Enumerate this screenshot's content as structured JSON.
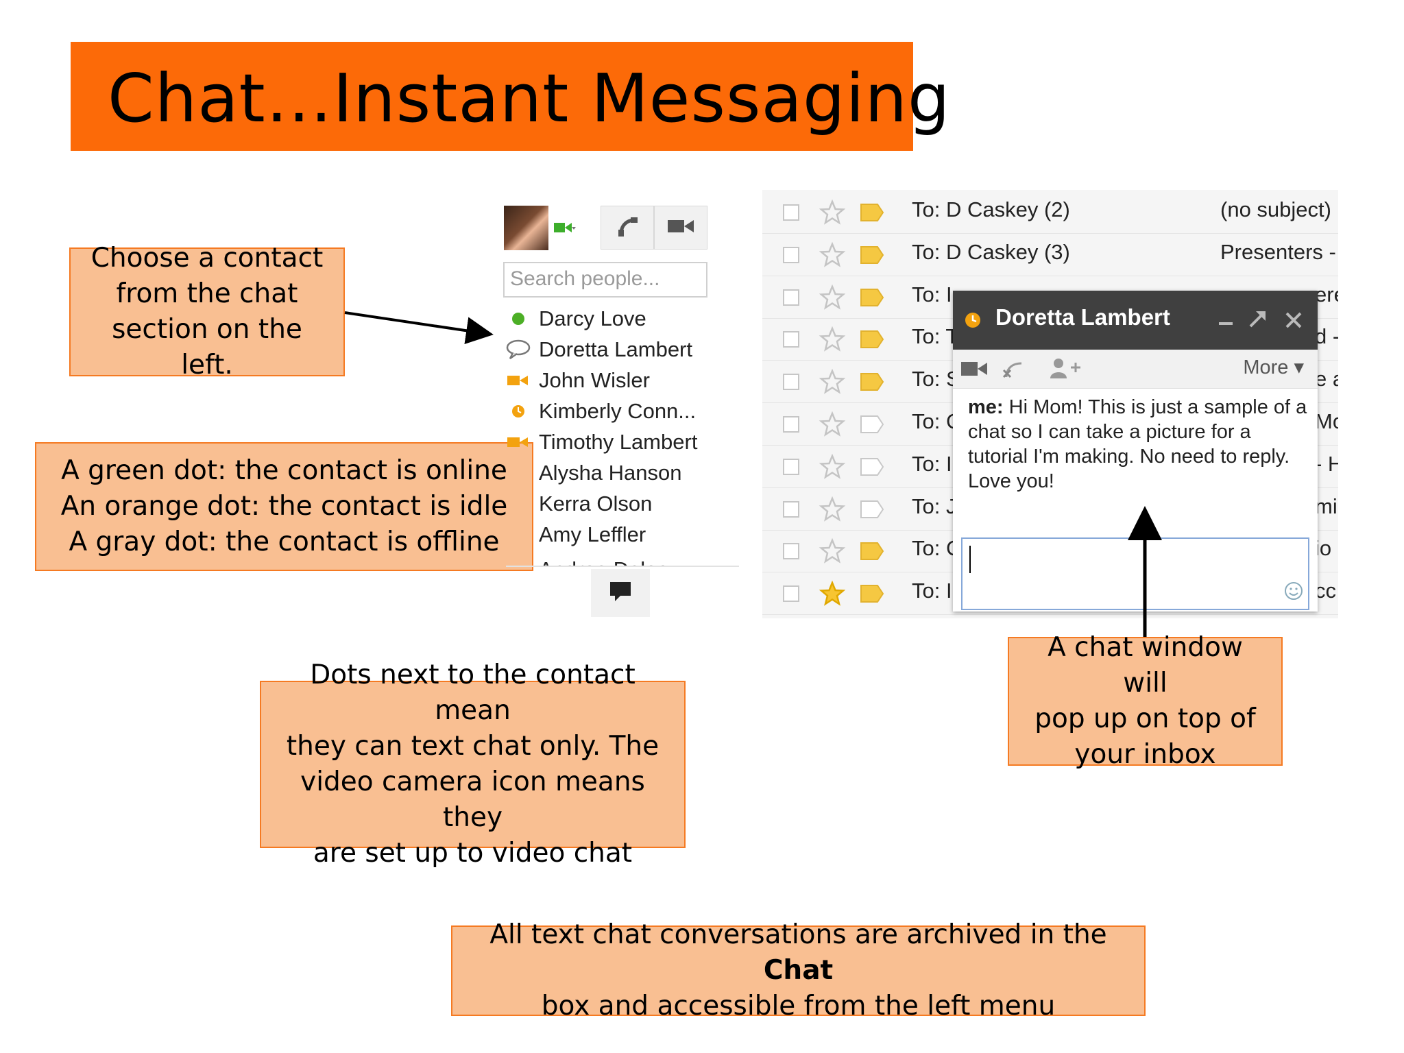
{
  "title": "Chat…Instant Messaging",
  "callouts": {
    "choose": "Choose a contact\nfrom the chat\nsection on the left.",
    "dots": "A green dot: the contact is online\nAn orange dot: the contact is idle\nA gray dot: the contact is offline",
    "text_only": "Dots next to the contact mean\nthey can text chat only.  The\nvideo camera icon means they\nare set up to video chat",
    "popup": "A chat window will\npop up on top of\nyour inbox",
    "archive_before": "All text chat conversations are archived in the ",
    "archive_bold": "Chat",
    "archive_after": "\nbox and accessible from the left menu"
  },
  "chat_panel": {
    "search_placeholder": "Search people...",
    "contacts": [
      {
        "name": "Darcy Love",
        "icon": "green-dot-icon"
      },
      {
        "name": "Doretta Lambert",
        "icon": "speech-bubble-icon"
      },
      {
        "name": "John Wisler",
        "icon": "video-camera-icon"
      },
      {
        "name": "Kimberly Conn...",
        "icon": "orange-idle-dot-icon"
      },
      {
        "name": "Timothy Lambert",
        "icon": "video-camera-icon"
      },
      {
        "name": "Alysha Hanson",
        "icon": ""
      },
      {
        "name": "Kerra Olson",
        "icon": ""
      },
      {
        "name": "Amy Leffler",
        "icon": ""
      },
      {
        "name": "Andrea Dalea",
        "icon": ""
      }
    ]
  },
  "inbox": {
    "rows": [
      {
        "to": "To: D Caskey (2)",
        "subject": "(no subject)",
        "edge": "",
        "starred": false,
        "tag": "yellow"
      },
      {
        "to": "To: D Caskey (3)",
        "subject": "Presenters -",
        "edge": "",
        "starred": false,
        "tag": "yellow"
      },
      {
        "to": "To: I",
        "subject": "",
        "edge": "ere",
        "starred": false,
        "tag": "yellow"
      },
      {
        "to": "To: T",
        "subject": "",
        "edge": "d -",
        "starred": false,
        "tag": "yellow"
      },
      {
        "to": "To: S",
        "subject": "",
        "edge": "e a",
        "starred": false,
        "tag": "yellow"
      },
      {
        "to": "To: C",
        "subject": "",
        "edge": "Mo",
        "starred": false,
        "tag": "white"
      },
      {
        "to": "To: I",
        "subject": "",
        "edge": "- H",
        "starred": false,
        "tag": "white"
      },
      {
        "to": "To: J",
        "subject": "",
        "edge": "mil",
        "starred": false,
        "tag": "white"
      },
      {
        "to": "To: C",
        "subject": "",
        "edge": "io",
        "starred": false,
        "tag": "yellow"
      },
      {
        "to": "To: I",
        "subject": "",
        "edge": "cc",
        "starred": true,
        "tag": "yellow"
      }
    ]
  },
  "chat_window": {
    "contact": "Doretta Lambert",
    "more_label": "More ▾",
    "sender": "me:",
    "message": "Hi Mom!  This is just a sample of a chat so I can take a picture for a tutorial I'm making.  No need to reply.  Love you!"
  },
  "colors": {
    "title_orange": "#fc6a08",
    "callout_fill": "#f9bf92",
    "online_green": "#4caf26",
    "idle_orange": "#f3a20f"
  }
}
